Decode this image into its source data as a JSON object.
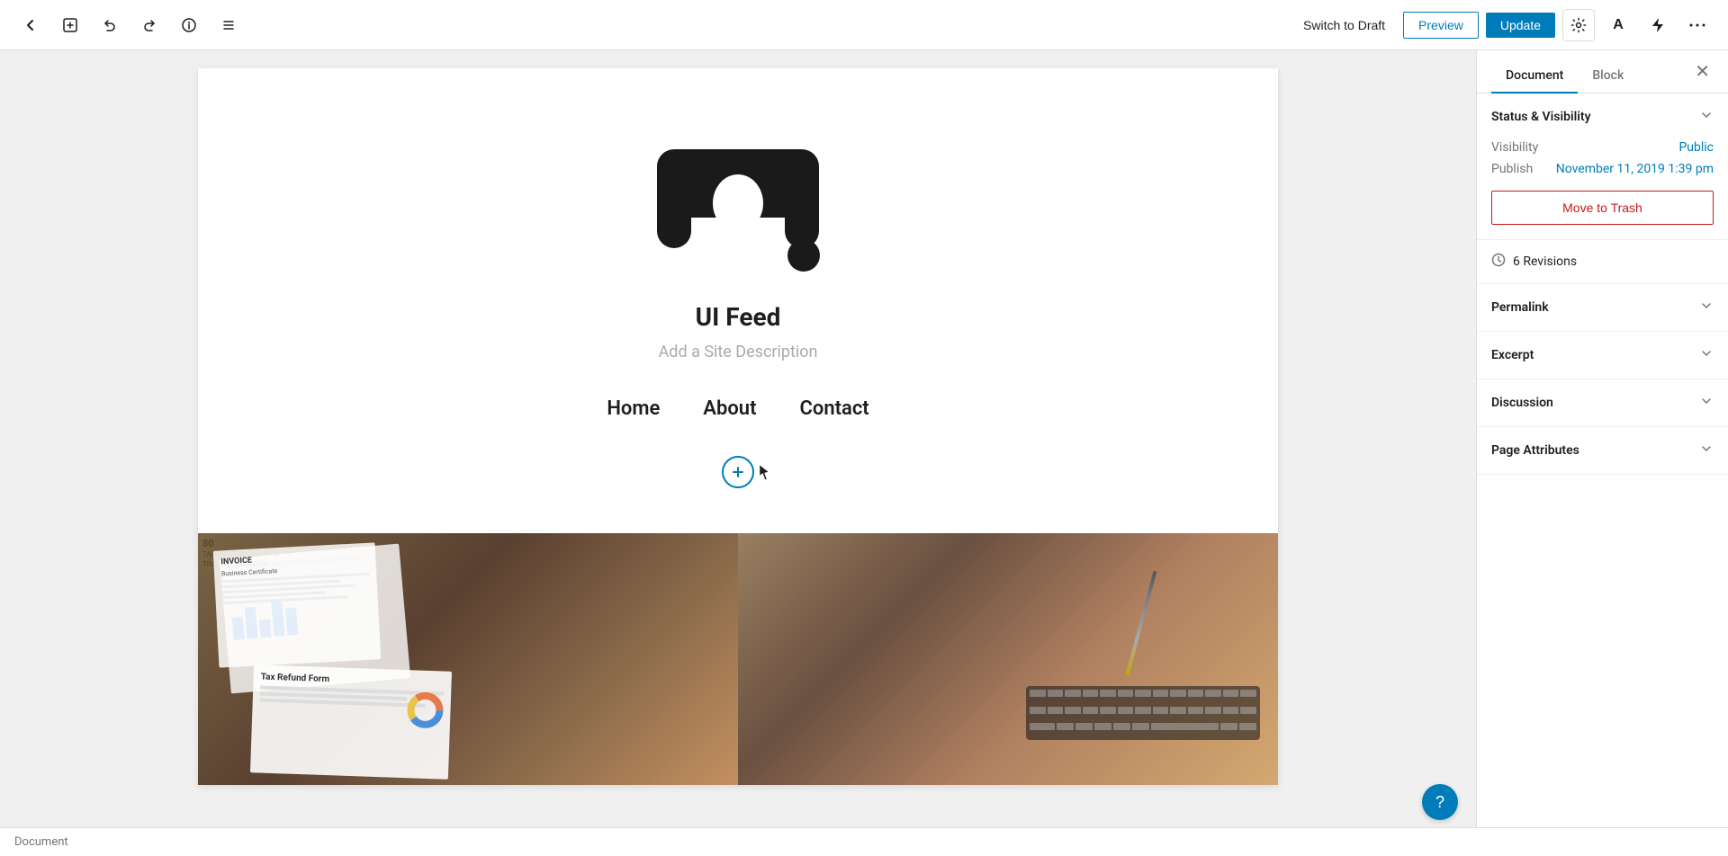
{
  "toolbar": {
    "back_label": "←",
    "add_label": "+",
    "undo_label": "↩",
    "redo_label": "↪",
    "info_label": "ℹ",
    "list_label": "≡",
    "switch_draft_label": "Switch to Draft",
    "preview_label": "Preview",
    "update_label": "Update",
    "settings_label": "⚙",
    "font_label": "A",
    "bolt_label": "⚡",
    "more_label": "⋯"
  },
  "sidebar": {
    "tab_document": "Document",
    "tab_block": "Block",
    "close_label": "✕",
    "status_visibility": {
      "section_title": "Status & Visibility",
      "visibility_label": "Visibility",
      "visibility_value": "Public",
      "publish_label": "Publish",
      "publish_value": "November 11, 2019 1:39 pm",
      "move_to_trash_label": "Move to Trash"
    },
    "revisions": {
      "icon": "🕐",
      "label": "6 Revisions"
    },
    "permalink": {
      "section_title": "Permalink"
    },
    "excerpt": {
      "section_title": "Excerpt"
    },
    "discussion": {
      "section_title": "Discussion"
    },
    "page_attributes": {
      "section_title": "Page Attributes"
    }
  },
  "canvas": {
    "site_title": "UI Feed",
    "site_description": "Add a Site Description",
    "nav_items": [
      "Home",
      "About",
      "Contact"
    ]
  },
  "status_bar": {
    "label": "Document"
  },
  "help": {
    "label": "?"
  }
}
